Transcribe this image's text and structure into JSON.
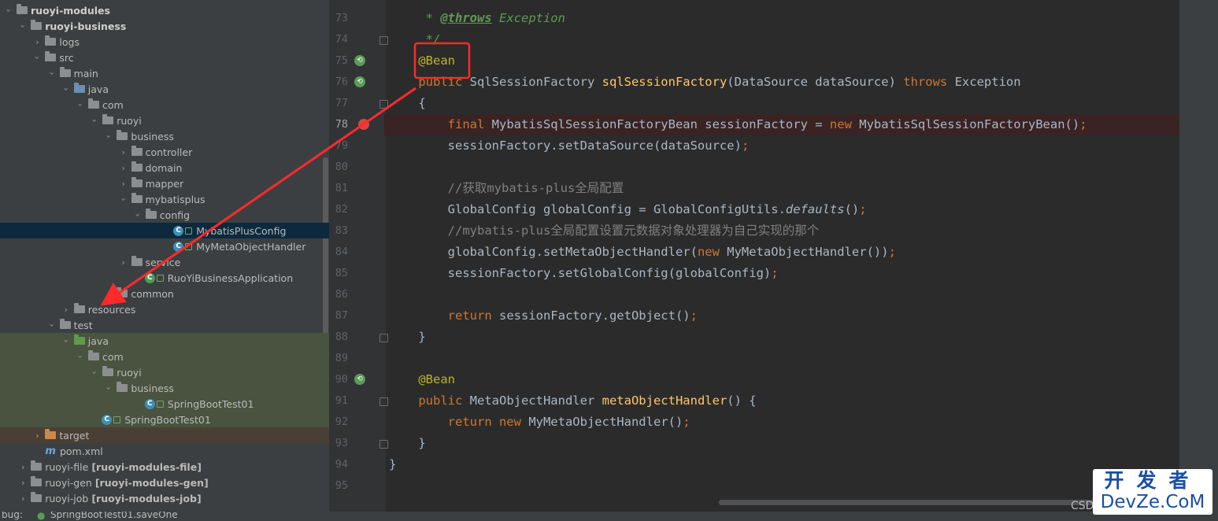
{
  "project_tree": [
    {
      "label": "ruoyi-modules",
      "indent": 0,
      "arrow": "open",
      "icon": "module",
      "bold": true
    },
    {
      "label": "ruoyi-business",
      "indent": 1,
      "arrow": "open",
      "icon": "module",
      "bold": true
    },
    {
      "label": "logs",
      "indent": 2,
      "arrow": "closed",
      "icon": "folder"
    },
    {
      "label": "src",
      "indent": 2,
      "arrow": "open",
      "icon": "folder"
    },
    {
      "label": "main",
      "indent": 3,
      "arrow": "open",
      "icon": "folder"
    },
    {
      "label": "java",
      "indent": 4,
      "arrow": "open",
      "icon": "source-folder"
    },
    {
      "label": "com",
      "indent": 5,
      "arrow": "open",
      "icon": "package"
    },
    {
      "label": "ruoyi",
      "indent": 6,
      "arrow": "open",
      "icon": "package"
    },
    {
      "label": "business",
      "indent": 7,
      "arrow": "open",
      "icon": "package"
    },
    {
      "label": "controller",
      "indent": 8,
      "arrow": "closed",
      "icon": "package"
    },
    {
      "label": "domain",
      "indent": 8,
      "arrow": "closed",
      "icon": "package"
    },
    {
      "label": "mapper",
      "indent": 8,
      "arrow": "closed",
      "icon": "package"
    },
    {
      "label": "mybatisplus",
      "indent": 8,
      "arrow": "open",
      "icon": "package"
    },
    {
      "label": "config",
      "indent": 9,
      "arrow": "open",
      "icon": "package"
    },
    {
      "label": "MybatisPlusConfig",
      "indent": 11,
      "arrow": "none",
      "icon": "class",
      "selected": true
    },
    {
      "label": "MyMetaObjectHandler",
      "indent": 11,
      "arrow": "none",
      "icon": "class"
    },
    {
      "label": "service",
      "indent": 8,
      "arrow": "closed",
      "icon": "package"
    },
    {
      "label": "RuoYiBusinessApplication",
      "indent": 9,
      "arrow": "none",
      "icon": "springboot-class"
    },
    {
      "label": "common",
      "indent": 7,
      "arrow": "closed",
      "icon": "package"
    },
    {
      "label": "resources",
      "indent": 4,
      "arrow": "closed",
      "icon": "resources-folder"
    },
    {
      "label": "test",
      "indent": 3,
      "arrow": "open",
      "icon": "folder"
    },
    {
      "label": "java",
      "indent": 4,
      "arrow": "open",
      "icon": "test-source-folder",
      "test": true
    },
    {
      "label": "com",
      "indent": 5,
      "arrow": "open",
      "icon": "package",
      "test": true
    },
    {
      "label": "ruoyi",
      "indent": 6,
      "arrow": "open",
      "icon": "package",
      "test": true
    },
    {
      "label": "business",
      "indent": 7,
      "arrow": "open",
      "icon": "package",
      "test": true
    },
    {
      "label": "SpringBootTest01",
      "indent": 9,
      "arrow": "none",
      "icon": "class",
      "test": true
    },
    {
      "label": "SpringBootTest01",
      "indent": 6,
      "arrow": "none",
      "icon": "class",
      "test": true
    },
    {
      "label": "target",
      "indent": 2,
      "arrow": "closed",
      "icon": "target-folder",
      "excluded": true
    },
    {
      "label": "pom.xml",
      "indent": 2,
      "arrow": "none",
      "icon": "maven-file"
    },
    {
      "label": "ruoyi-file",
      "tag": "[ruoyi-modules-file]",
      "indent": 1,
      "arrow": "closed",
      "icon": "module"
    },
    {
      "label": "ruoyi-gen",
      "tag": "[ruoyi-modules-gen]",
      "indent": 1,
      "arrow": "closed",
      "icon": "module"
    },
    {
      "label": "ruoyi-job",
      "tag": "[ruoyi-modules-job]",
      "indent": 1,
      "arrow": "closed",
      "icon": "module"
    }
  ],
  "code_lines": [
    {
      "n": "73",
      "segs": [
        [
          "doc",
          "     * "
        ],
        [
          "doctag",
          "@throws"
        ],
        [
          "doc",
          " Exception"
        ]
      ]
    },
    {
      "n": "74",
      "segs": [
        [
          "doc",
          "     */"
        ]
      ]
    },
    {
      "n": "75",
      "segs": [
        [
          "ann",
          "    @Bean"
        ]
      ]
    },
    {
      "n": "76",
      "segs": [
        [
          "kw",
          "    public "
        ],
        [
          "t",
          "SqlSessionFactory "
        ],
        [
          "fn",
          "sqlSessionFactory"
        ],
        [
          "t",
          "(DataSource dataSource) "
        ],
        [
          "kw",
          "throws "
        ],
        [
          "t",
          "Exception"
        ]
      ]
    },
    {
      "n": "77",
      "segs": [
        [
          "t",
          "    {"
        ]
      ]
    },
    {
      "n": "78",
      "segs": [
        [
          "kw",
          "        final "
        ],
        [
          "t",
          "MybatisSqlSessionFactoryBean sessionFactory = "
        ],
        [
          "kw",
          "new "
        ],
        [
          "t",
          "MybatisSqlSessionFactoryBean()"
        ],
        [
          "kw",
          ";"
        ]
      ]
    },
    {
      "n": "79",
      "segs": [
        [
          "t",
          "        sessionFactory.setDataSource(dataSource)"
        ],
        [
          "kw",
          ";"
        ]
      ]
    },
    {
      "n": "80",
      "segs": []
    },
    {
      "n": "81",
      "segs": [
        [
          "cm",
          "        //获取mybatis-plus全局配置"
        ]
      ]
    },
    {
      "n": "82",
      "segs": [
        [
          "t",
          "        GlobalConfig globalConfig = GlobalConfigUtils."
        ],
        [
          "it",
          "defaults"
        ],
        [
          "t",
          "()"
        ],
        [
          "kw",
          ";"
        ]
      ]
    },
    {
      "n": "83",
      "segs": [
        [
          "cm",
          "        //mybatis-plus全局配置设置元数据对象处理器为自己实现的那个"
        ]
      ]
    },
    {
      "n": "84",
      "segs": [
        [
          "t",
          "        globalConfig.setMetaObjectHandler("
        ],
        [
          "kw",
          "new "
        ],
        [
          "t",
          "MyMetaObjectHandler())"
        ],
        [
          "kw",
          ";"
        ]
      ]
    },
    {
      "n": "85",
      "segs": [
        [
          "t",
          "        sessionFactory.setGlobalConfig(globalConfig)"
        ],
        [
          "kw",
          ";"
        ]
      ]
    },
    {
      "n": "86",
      "segs": []
    },
    {
      "n": "87",
      "segs": [
        [
          "kw",
          "        return "
        ],
        [
          "t",
          "sessionFactory.getObject()"
        ],
        [
          "kw",
          ";"
        ]
      ]
    },
    {
      "n": "88",
      "segs": [
        [
          "t",
          "    }"
        ]
      ]
    },
    {
      "n": "89",
      "segs": []
    },
    {
      "n": "90",
      "segs": [
        [
          "ann",
          "    @Bean"
        ]
      ]
    },
    {
      "n": "91",
      "segs": [
        [
          "kw",
          "    public "
        ],
        [
          "t",
          "MetaObjectHandler "
        ],
        [
          "fn",
          "metaObjectHandler"
        ],
        [
          "t",
          "() {"
        ]
      ]
    },
    {
      "n": "92",
      "segs": [
        [
          "kw",
          "        return new "
        ],
        [
          "t",
          "MyMetaObjectHandler()"
        ],
        [
          "kw",
          ";"
        ]
      ]
    },
    {
      "n": "93",
      "segs": [
        [
          "t",
          "    }"
        ]
      ]
    },
    {
      "n": "94",
      "segs": [
        [
          "t",
          "}"
        ]
      ]
    },
    {
      "n": "95",
      "segs": []
    }
  ],
  "status": {
    "prefix": "bug:",
    "tab": "SpringBootTest01.saveOne"
  },
  "watermark": {
    "line1": "开发者",
    "line2": "DevZe.CoM"
  },
  "csdn_fragment": "CSD",
  "colors": {
    "keyword": "#cc7832",
    "function": "#ffc66d",
    "annotation": "#bbb529",
    "comment": "#808080",
    "doc": "#629755",
    "text": "#a9b7c6",
    "highlight_box": "#ff2a2a",
    "arrow": "#ff2a2a"
  }
}
